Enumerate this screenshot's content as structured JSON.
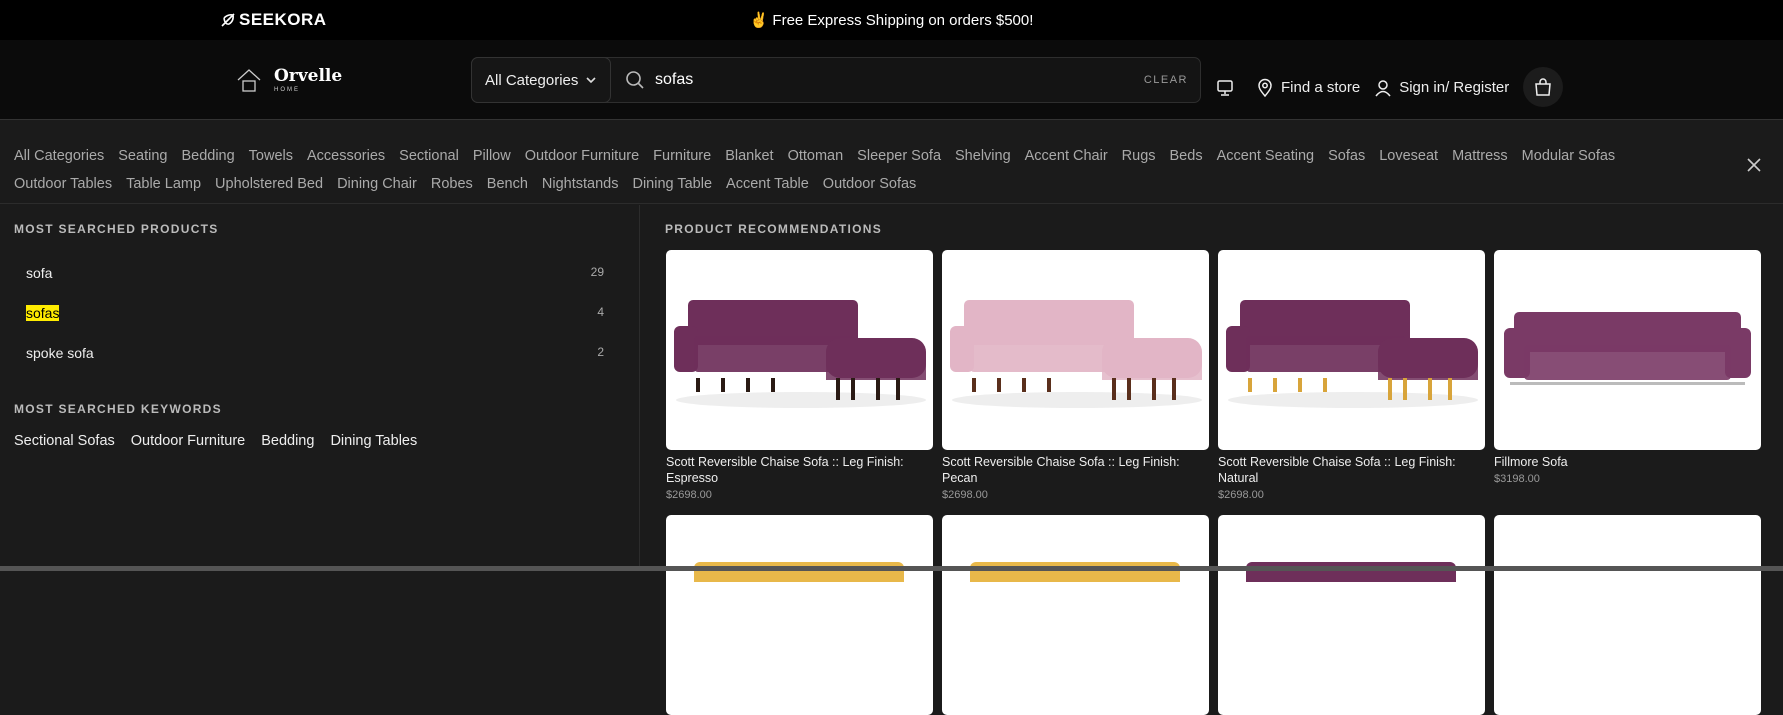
{
  "topbar": {
    "logo": "SEEKORA",
    "promo": "✌️ Free Express Shipping on orders $500!"
  },
  "header": {
    "brand_name": "Orvelle",
    "brand_sub": "HOME",
    "category_select": "All Categories",
    "search_value": "sofas",
    "clear_label": "CLEAR",
    "find_store": "Find a store",
    "sign_in": "Sign in/ Register"
  },
  "categories": [
    "All Categories",
    "Seating",
    "Bedding",
    "Towels",
    "Accessories",
    "Sectional",
    "Pillow",
    "Outdoor Furniture",
    "Furniture",
    "Blanket",
    "Ottoman",
    "Sleeper Sofa",
    "Shelving",
    "Accent Chair",
    "Rugs",
    "Beds",
    "Accent Seating",
    "Sofas",
    "Loveseat",
    "Mattress",
    "Modular Sofas",
    "Outdoor Tables",
    "Table Lamp",
    "Upholstered Bed",
    "Dining Chair",
    "Robes",
    "Bench",
    "Nightstands",
    "Dining Table",
    "Accent Table",
    "Outdoor Sofas"
  ],
  "most_searched_products": {
    "title": "MOST SEARCHED PRODUCTS",
    "items": [
      {
        "label": "sofa",
        "count": "29"
      },
      {
        "label": "sofas",
        "count": "4"
      },
      {
        "label": "spoke sofa",
        "count": "2"
      }
    ]
  },
  "most_searched_keywords": {
    "title": "MOST SEARCHED KEYWORDS",
    "items": [
      "Sectional Sofas",
      "Outdoor Furniture",
      "Bedding",
      "Dining Tables"
    ]
  },
  "recommendations": {
    "title": "PRODUCT RECOMMENDATIONS",
    "products": [
      {
        "name": "Scott Reversible Chaise Sofa :: Leg Finish: Espresso",
        "price": "$2698.00",
        "color": "#6e2f5a",
        "leg": "#2a1a14"
      },
      {
        "name": "Scott Reversible Chaise Sofa :: Leg Finish: Pecan",
        "price": "$2698.00",
        "color": "#e2b5c6",
        "leg": "#5a2f1c"
      },
      {
        "name": "Scott Reversible Chaise Sofa :: Leg Finish: Natural",
        "price": "$2698.00",
        "color": "#6e2f5a",
        "leg": "#d8a43a"
      },
      {
        "name": "Fillmore Sofa",
        "price": "$3198.00",
        "color": "#7a3a66",
        "leg": "#bbbbbb"
      }
    ],
    "row2_colors": [
      "#e8b84a",
      "#e8b84a",
      "#6e2f5a",
      "#ffffff"
    ]
  }
}
